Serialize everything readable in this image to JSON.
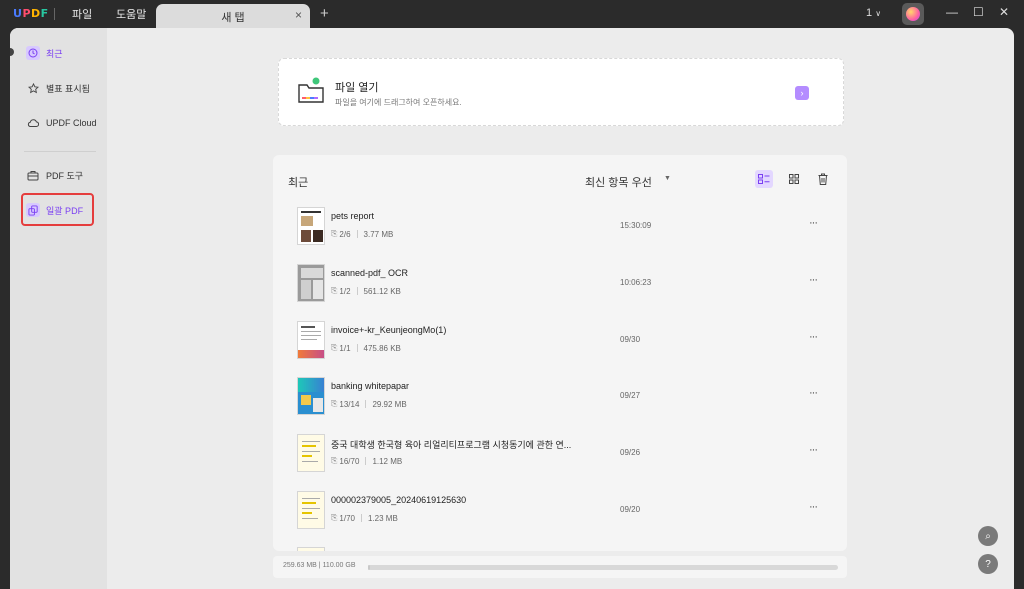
{
  "titlebar": {
    "logo": {
      "u": "U",
      "p": "P",
      "d": "D",
      "f": "F"
    },
    "menus": [
      "파일",
      "도움말"
    ],
    "tab_title": "새 탭",
    "tab_close": "×",
    "tab_add": "+",
    "count": "1",
    "minimize": "—",
    "maximize": "☐",
    "close": "✕"
  },
  "sidebar": {
    "items": [
      {
        "label": "최근",
        "icon": "clock-icon",
        "active": true
      },
      {
        "label": "별표 표시됨",
        "icon": "star-icon"
      },
      {
        "label": "UPDF Cloud",
        "icon": "cloud-icon"
      },
      {
        "label": "PDF 도구",
        "icon": "toolbox-icon"
      },
      {
        "label": "일괄 PDF",
        "icon": "batch-icon",
        "active": true
      }
    ]
  },
  "open_card": {
    "title": "파일 열기",
    "subtitle": "파일을 여기에 드래그하여 오픈하세요.",
    "go": "›"
  },
  "recent": {
    "title": "최근",
    "sort_label": "최신 항목 우선",
    "sort_arrow": "▼",
    "files": [
      {
        "name": "pets report",
        "pages": "2/6",
        "size": "3.77 MB",
        "time": "15:30:09",
        "thumb": "pets"
      },
      {
        "name": "scanned-pdf_ OCR",
        "pages": "1/2",
        "size": "561.12 KB",
        "time": "10:06:23",
        "thumb": "scan"
      },
      {
        "name": "invoice+-kr_KeunjeongMo(1)",
        "pages": "1/1",
        "size": "475.86 KB",
        "time": "09/30",
        "thumb": "invoice"
      },
      {
        "name": "banking whitepapar",
        "pages": "13/14",
        "size": "29.92 MB",
        "time": "09/27",
        "thumb": "bank"
      },
      {
        "name": "중국 대학생 한국형 육아 리얼리티프로그램 시청동기에 관한 연...",
        "pages": "16/70",
        "size": "1.12 MB",
        "time": "09/26",
        "thumb": "paper"
      },
      {
        "name": "000002379005_20240619125630",
        "pages": "1/70",
        "size": "1.23 MB",
        "time": "09/20",
        "thumb": "paper"
      }
    ],
    "more": "···"
  },
  "storage": {
    "text": "259.63 MB | 110.00 GB",
    "fraction": 0.0023
  },
  "float": {
    "search": "⌕",
    "help": "?"
  },
  "colors": {
    "accent": "#7a3ff2",
    "highlight": "#e53d3d"
  }
}
